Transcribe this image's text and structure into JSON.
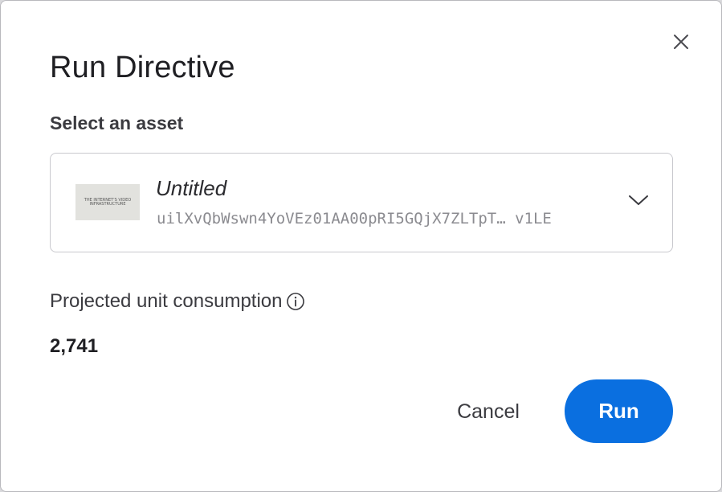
{
  "dialog": {
    "title": "Run Directive",
    "close_icon": "close-icon"
  },
  "asset": {
    "section_label": "Select an asset",
    "name": "Untitled",
    "id_text": "uilXvQbWswn4YoVEz01AA00pRI5GQjX7ZLTpT… v1LE",
    "thumbnail_text": "THE INTERNET'S VIDEO INFRASTRUCTURE",
    "chevron_icon": "chevron-down-icon"
  },
  "consumption": {
    "label": "Projected unit consumption",
    "info_icon": "info-icon",
    "value": "2,741"
  },
  "actions": {
    "cancel_label": "Cancel",
    "run_label": "Run"
  },
  "colors": {
    "primary": "#0a6fe0",
    "text": "#1f1f23",
    "muted": "#8b8b90",
    "border": "#c9c9ce"
  }
}
